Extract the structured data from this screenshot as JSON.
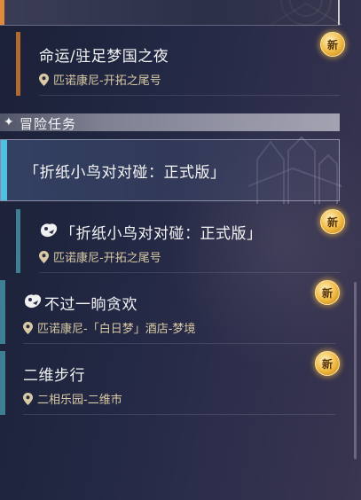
{
  "badge_label": "新",
  "colors": {
    "accent_orange": "#e08a3c",
    "accent_cyan": "#4ec0e4",
    "accent_teal": "#3f7f93",
    "location_text": "#d9c9a4",
    "badge_gold": "#f0b840"
  },
  "quests_top": {
    "title": "命运/驻足梦国之夜",
    "location": "匹诺康尼-开拓之尾号"
  },
  "section": {
    "icon": "diamond-icon",
    "label": "冒险任务"
  },
  "featured": {
    "title": "「折纸小鸟对对碰：正式版」"
  },
  "quests": [
    {
      "icon": "paper-bird-icon",
      "title": "「折纸小鸟对对碰：正式版」",
      "location": "匹诺康尼-开拓之尾号"
    },
    {
      "icon": "paper-bird-icon",
      "title": "不过一晌贪欢",
      "location": "匹诺康尼-「白日梦」酒店-梦境"
    },
    {
      "title": "二维步行",
      "location": "二相乐园-二维市"
    }
  ]
}
